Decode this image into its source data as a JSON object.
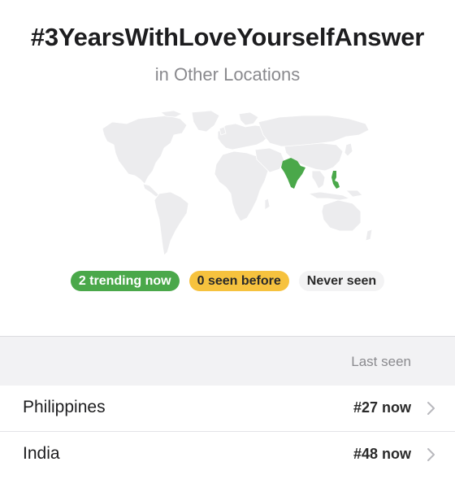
{
  "header": {
    "title": "#3YearsWithLoveYourselfAnswer",
    "subtitle": "in Other Locations"
  },
  "map": {
    "icon": "world-map",
    "base_color": "#ececee",
    "highlight_color": "#4aa84a",
    "highlighted_regions": [
      "India",
      "Philippines"
    ]
  },
  "legend": {
    "trending": "2 trending now",
    "seen_before": "0 seen before",
    "never_seen": "Never seen",
    "colors": {
      "trending": "#4aa84a",
      "seen_before": "#f6c23e",
      "never_seen": "#f3f3f4"
    }
  },
  "table": {
    "column_header": "Last seen",
    "rows": [
      {
        "country": "Philippines",
        "rank": "#27 now"
      },
      {
        "country": "India",
        "rank": "#48 now"
      }
    ]
  }
}
